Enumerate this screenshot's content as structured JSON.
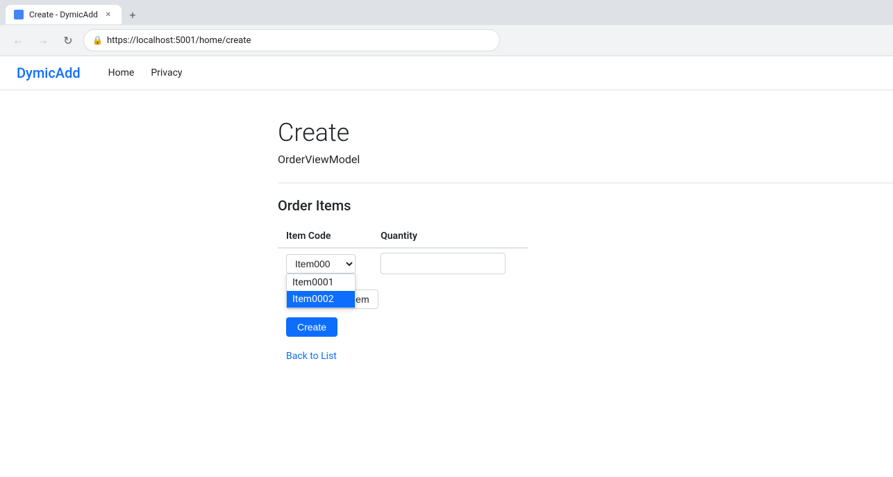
{
  "browser": {
    "tab_title": "Create - DymicAdd",
    "url": "https://localhost:5001/home/create",
    "tab_favicon": "📄"
  },
  "navbar": {
    "brand": "DymicAdd",
    "links": [
      "Home",
      "Privacy"
    ]
  },
  "page": {
    "title": "Create",
    "subtitle": "OrderViewModel"
  },
  "order_items": {
    "section_title": "Order Items",
    "columns": {
      "item_code": "Item Code",
      "quantity": "Quantity"
    },
    "select_value": "Item0001",
    "select_options": [
      "Item0001",
      "Item0002"
    ],
    "dropdown_option1": "Item0001",
    "dropdown_option2": "Item0002",
    "quantity_placeholder": "",
    "add_another_label": "Add another item",
    "create_label": "Create",
    "back_label": "Back to List"
  }
}
